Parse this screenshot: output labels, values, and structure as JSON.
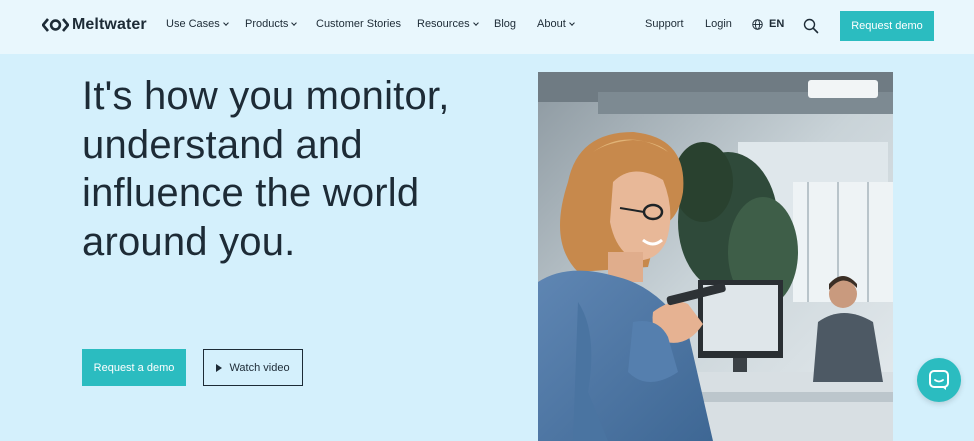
{
  "brand": {
    "name": "Meltwater"
  },
  "nav": {
    "items": [
      {
        "label": "Use Cases",
        "has_dropdown": true
      },
      {
        "label": "Products",
        "has_dropdown": true
      },
      {
        "label": "Customer Stories",
        "has_dropdown": false
      },
      {
        "label": "Resources",
        "has_dropdown": true
      },
      {
        "label": "Blog",
        "has_dropdown": false
      },
      {
        "label": "About",
        "has_dropdown": true
      }
    ],
    "support": "Support",
    "login": "Login",
    "language": "EN",
    "cta": "Request demo"
  },
  "hero": {
    "headline": "It's how you monitor, understand and influence the world around you.",
    "primary_cta": "Request a demo",
    "secondary_cta": "Watch video"
  },
  "colors": {
    "accent": "#2bbcc0",
    "hero_background": "#d4f0fc",
    "nav_background": "#e9f7fd",
    "text": "#1d2b36"
  }
}
